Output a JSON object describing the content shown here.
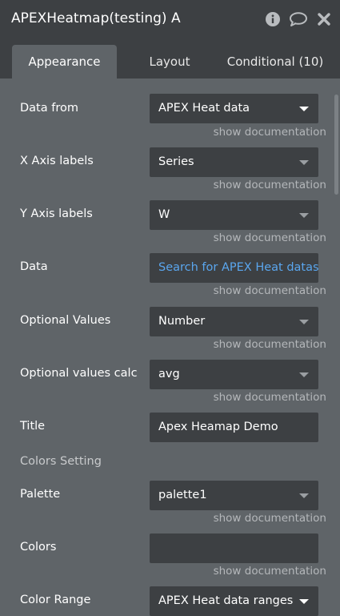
{
  "window": {
    "title": "APEXHeatmap(testing) A",
    "icons": [
      "info-icon",
      "comment-icon",
      "close-icon"
    ]
  },
  "tabs": [
    {
      "label": "Appearance",
      "active": true
    },
    {
      "label": "Layout",
      "active": false
    },
    {
      "label": "Conditional (10)",
      "active": false
    }
  ],
  "fields": {
    "data_from": {
      "label": "Data from",
      "value": "APEX Heat data",
      "doc": "show documentation"
    },
    "x_axis_labels": {
      "label": "X Axis labels",
      "value": "Series",
      "doc": "show documentation"
    },
    "y_axis_labels": {
      "label": "Y Axis labels",
      "value": "W",
      "doc": "show documentation"
    },
    "data": {
      "label": "Data",
      "value": "Search for APEX Heat datas",
      "doc": "show documentation"
    },
    "optional_values": {
      "label": "Optional Values",
      "value": "Number",
      "doc": "show documentation"
    },
    "optional_values_calc": {
      "label": "Optional values calc",
      "value": "avg",
      "doc": "show documentation"
    },
    "title": {
      "label": "Title",
      "value": "Apex Heamap Demo"
    },
    "colors_setting": {
      "label": "Colors Setting"
    },
    "palette": {
      "label": "Palette",
      "value": "palette1",
      "doc": "show documentation"
    },
    "colors": {
      "label": "Colors",
      "value": "",
      "doc": "show documentation"
    },
    "color_range": {
      "label": "Color Range",
      "value": "APEX Heat data ranges"
    }
  },
  "colors": {
    "panel_bg": "#5f6468",
    "header_bg": "#3d4043",
    "input_bg": "#3d4043",
    "link": "#5aa6ee"
  }
}
